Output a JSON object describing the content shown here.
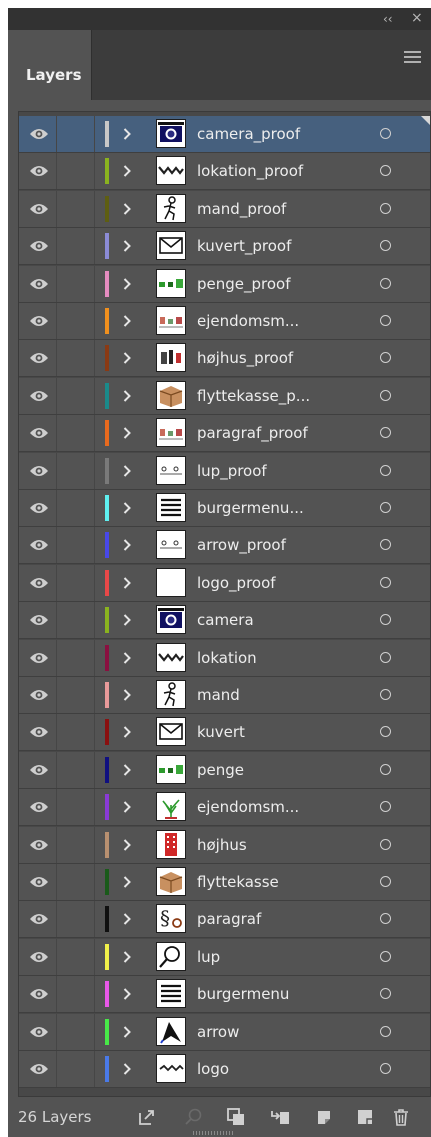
{
  "window": {
    "collapse_glyph": "‹‹",
    "close_glyph": "×"
  },
  "panel": {
    "tab_label": "Layers",
    "menu_icon": "hamburger-menu-icon"
  },
  "layers": [
    {
      "name": "camera_proof",
      "color": "#c8c8c8",
      "thumb": "camera",
      "selected": true
    },
    {
      "name": "lokation_proof",
      "color": "#8ab31f",
      "thumb": "wave",
      "selected": false
    },
    {
      "name": "mand_proof",
      "color": "#5e5e12",
      "thumb": "runner",
      "selected": false
    },
    {
      "name": "kuvert_proof",
      "color": "#8b8bd6",
      "thumb": "envelope",
      "selected": false
    },
    {
      "name": "penge_proof",
      "color": "#e58cc0",
      "thumb": "dots-green",
      "selected": false
    },
    {
      "name": "ejendomsm...",
      "color": "#f0901e",
      "thumb": "dots-mixed",
      "selected": false
    },
    {
      "name": "højhus_proof",
      "color": "#8a3a14",
      "thumb": "building",
      "selected": false
    },
    {
      "name": "flyttekasse_p...",
      "color": "#1a8a8a",
      "thumb": "box",
      "selected": false
    },
    {
      "name": "paragraf_proof",
      "color": "#e86a1e",
      "thumb": "dots-mixed",
      "selected": false
    },
    {
      "name": "lup_proof",
      "color": "#7a7a7a",
      "thumb": "dots-small",
      "selected": false
    },
    {
      "name": "burgermenu...",
      "color": "#5ff0f0",
      "thumb": "lines",
      "selected": false
    },
    {
      "name": "arrow_proof",
      "color": "#4848e8",
      "thumb": "dots-small",
      "selected": false
    },
    {
      "name": "logo_proof",
      "color": "#e84848",
      "thumb": "blank",
      "selected": false
    },
    {
      "name": "camera",
      "color": "#8ab31f",
      "thumb": "camera",
      "selected": false
    },
    {
      "name": "lokation",
      "color": "#8a1040",
      "thumb": "wave",
      "selected": false
    },
    {
      "name": "mand",
      "color": "#e89a9a",
      "thumb": "runner",
      "selected": false
    },
    {
      "name": "kuvert",
      "color": "#8a1010",
      "thumb": "envelope",
      "selected": false
    },
    {
      "name": "penge",
      "color": "#101080",
      "thumb": "dots-green",
      "selected": false
    },
    {
      "name": "ejendomsm...",
      "color": "#8a3ad6",
      "thumb": "plant",
      "selected": false
    },
    {
      "name": "højhus",
      "color": "#b89070",
      "thumb": "building-red",
      "selected": false
    },
    {
      "name": "flyttekasse",
      "color": "#1a5a1a",
      "thumb": "box",
      "selected": false
    },
    {
      "name": "paragraf",
      "color": "#101010",
      "thumb": "paragraph",
      "selected": false
    },
    {
      "name": "lup",
      "color": "#f0f04a",
      "thumb": "magnifier",
      "selected": false
    },
    {
      "name": "burgermenu",
      "color": "#e858e8",
      "thumb": "lines",
      "selected": false
    },
    {
      "name": "arrow",
      "color": "#48e848",
      "thumb": "arrow",
      "selected": false
    },
    {
      "name": "logo",
      "color": "#4a7ae8",
      "thumb": "wave-small",
      "selected": false
    }
  ],
  "footer": {
    "count_label": "26 Layers",
    "icons": [
      "export-icon",
      "search-icon",
      "clipping-mask-icon",
      "move-to-layer-icon",
      "new-sublayer-icon",
      "new-layer-icon",
      "delete-icon"
    ]
  }
}
